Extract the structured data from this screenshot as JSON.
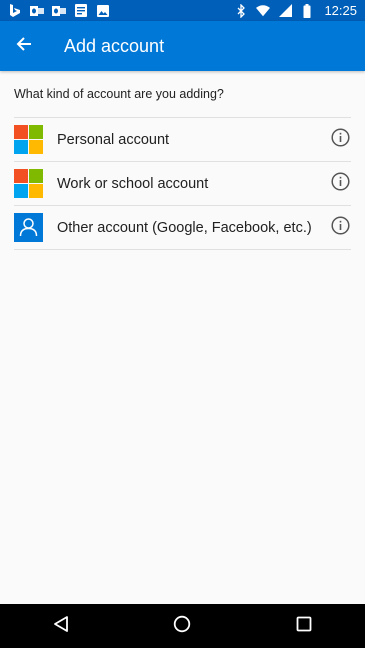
{
  "status_bar": {
    "time": "12:25",
    "left_icons": [
      "bing-icon",
      "outlook-icon",
      "outlook-icon",
      "docs-icon",
      "image-icon"
    ],
    "right_icons": [
      "bluetooth-icon",
      "wifi-icon",
      "signal-icon",
      "battery-icon"
    ]
  },
  "app_bar": {
    "title": "Add account",
    "back_icon": "arrow-back-icon"
  },
  "prompt": "What kind of account are you adding?",
  "accounts": [
    {
      "label": "Personal account",
      "icon": "microsoft-logo-icon"
    },
    {
      "label": "Work or school account",
      "icon": "microsoft-logo-icon"
    },
    {
      "label": "Other account (Google, Facebook, etc.)",
      "icon": "person-icon"
    }
  ],
  "colors": {
    "status_bar": "#005fb8",
    "app_bar": "#0078d7",
    "ms_red": "#f25022",
    "ms_green": "#7fba00",
    "ms_blue": "#00a4ef",
    "ms_yellow": "#ffb900",
    "person_tile": "#0078d7"
  },
  "nav_bar": {
    "buttons": [
      "back-triangle-icon",
      "home-circle-icon",
      "recents-square-icon"
    ]
  }
}
